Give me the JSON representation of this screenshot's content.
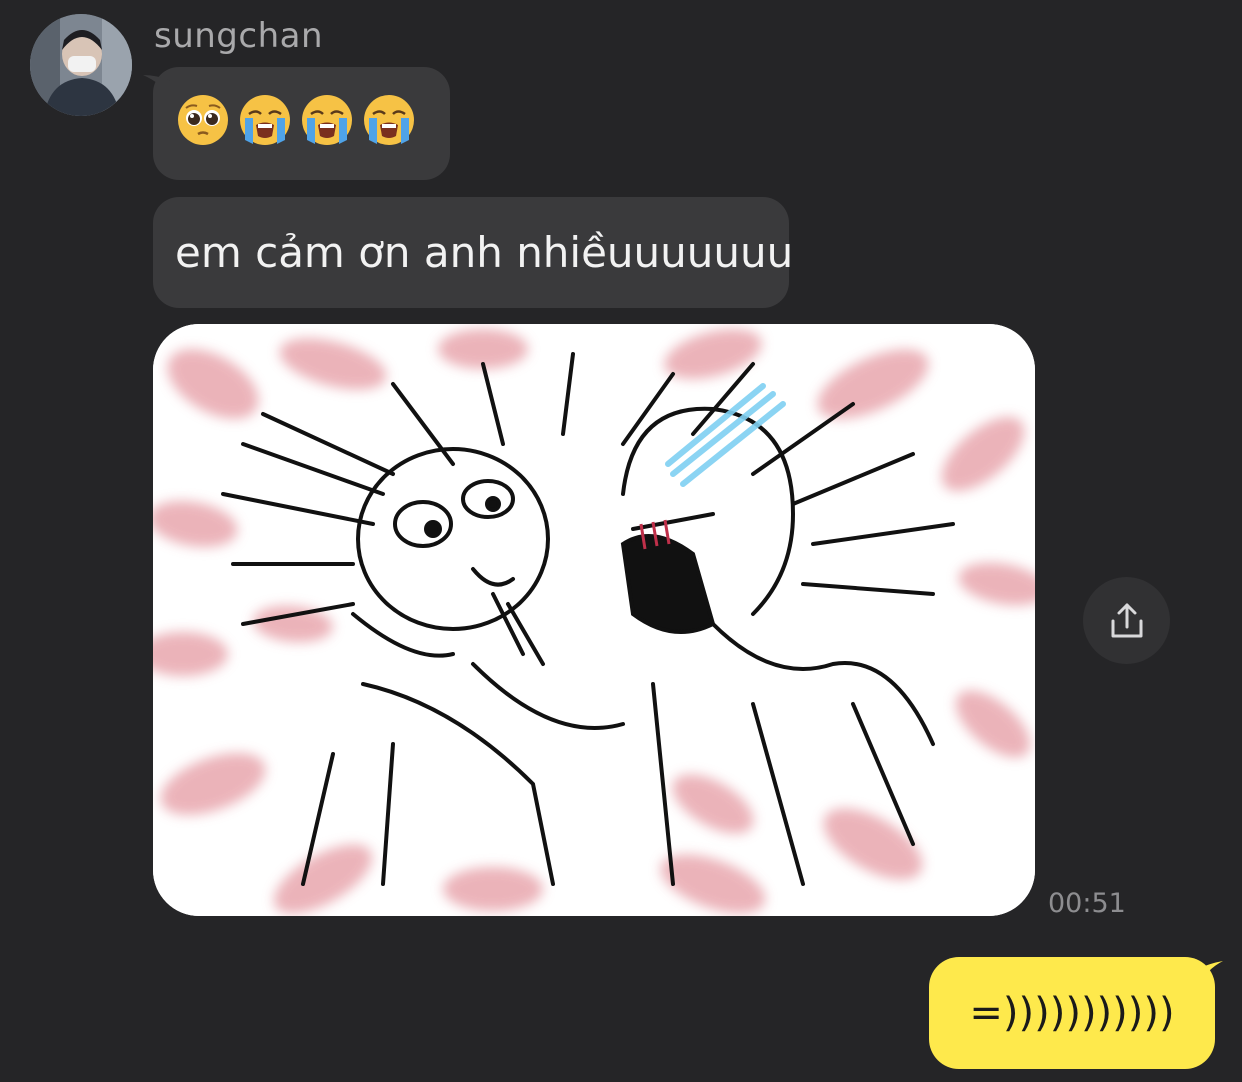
{
  "sender": {
    "name": "sungchan"
  },
  "messages": {
    "emoji_bubble": {
      "emojis": [
        "pleading-face",
        "loudly-crying-face",
        "loudly-crying-face",
        "loudly-crying-face"
      ]
    },
    "text_bubble": {
      "text": "em cảm ơn anh nhiềuuuuuuu"
    },
    "image": {
      "description_icon": "sketch-meme-image"
    },
    "timestamp": "00:51",
    "outgoing": {
      "text": "=)))))))))))"
    }
  },
  "icons": {
    "share": "share-icon"
  },
  "colors": {
    "background": "#252527",
    "incoming_bubble": "#3a3a3c",
    "outgoing_bubble": "#fee94c",
    "timestamp": "#8d8d90"
  }
}
